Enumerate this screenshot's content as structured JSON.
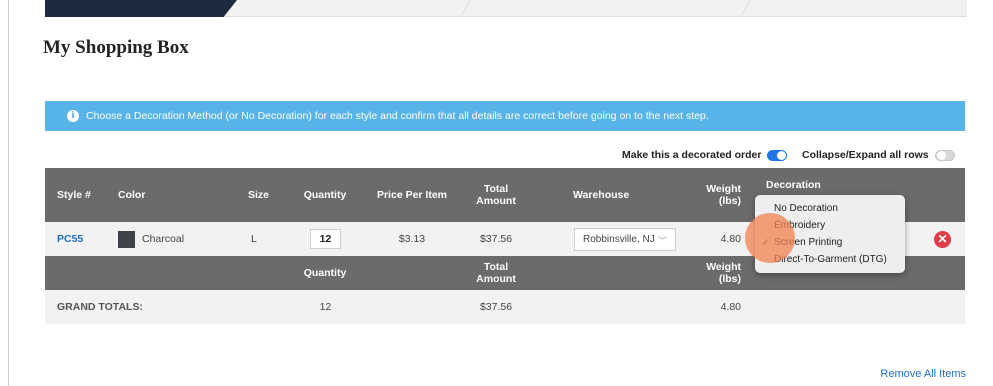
{
  "page": {
    "title": "My Shopping Box"
  },
  "banner": {
    "text": "Choose a Decoration Method (or No Decoration) for each style and confirm that all details are correct before going on to the next step."
  },
  "toggles": {
    "decorated_label": "Make this a decorated order",
    "decorated_on": true,
    "collapse_label": "Collapse/Expand all rows",
    "collapse_on": false
  },
  "table": {
    "headers": {
      "style": "Style #",
      "color": "Color",
      "size": "Size",
      "quantity": "Quantity",
      "price": "Price Per Item",
      "total": "Total Amount",
      "warehouse": "Warehouse",
      "weight": "Weight (lbs)",
      "decoration": "Decoration"
    },
    "items": [
      {
        "style": "PC55",
        "color": "Charcoal",
        "color_hex": "#3e4349",
        "size": "L",
        "quantity": "12",
        "price": "$3.13",
        "total": "$37.56",
        "warehouse": "Robbinsville, NJ",
        "weight": "4.80"
      }
    ],
    "totals_headers": {
      "quantity": "Quantity",
      "total": "Total Amount",
      "weight": "Weight (lbs)"
    },
    "grand_totals": {
      "label": "GRAND TOTALS:",
      "quantity": "12",
      "total": "$37.56",
      "weight": "4.80"
    }
  },
  "decoration_menu": {
    "options": [
      "No Decoration",
      "Embroidery",
      "Screen Printing",
      "Direct-To-Garment (DTG)"
    ],
    "selected": "Screen Printing",
    "check_glyph": "✓"
  },
  "actions": {
    "remove_all": "Remove All Items"
  },
  "colors": {
    "accent": "#1f74e8",
    "banner": "#58b4e8",
    "header": "#6b6b6b",
    "danger": "#de3d47"
  }
}
